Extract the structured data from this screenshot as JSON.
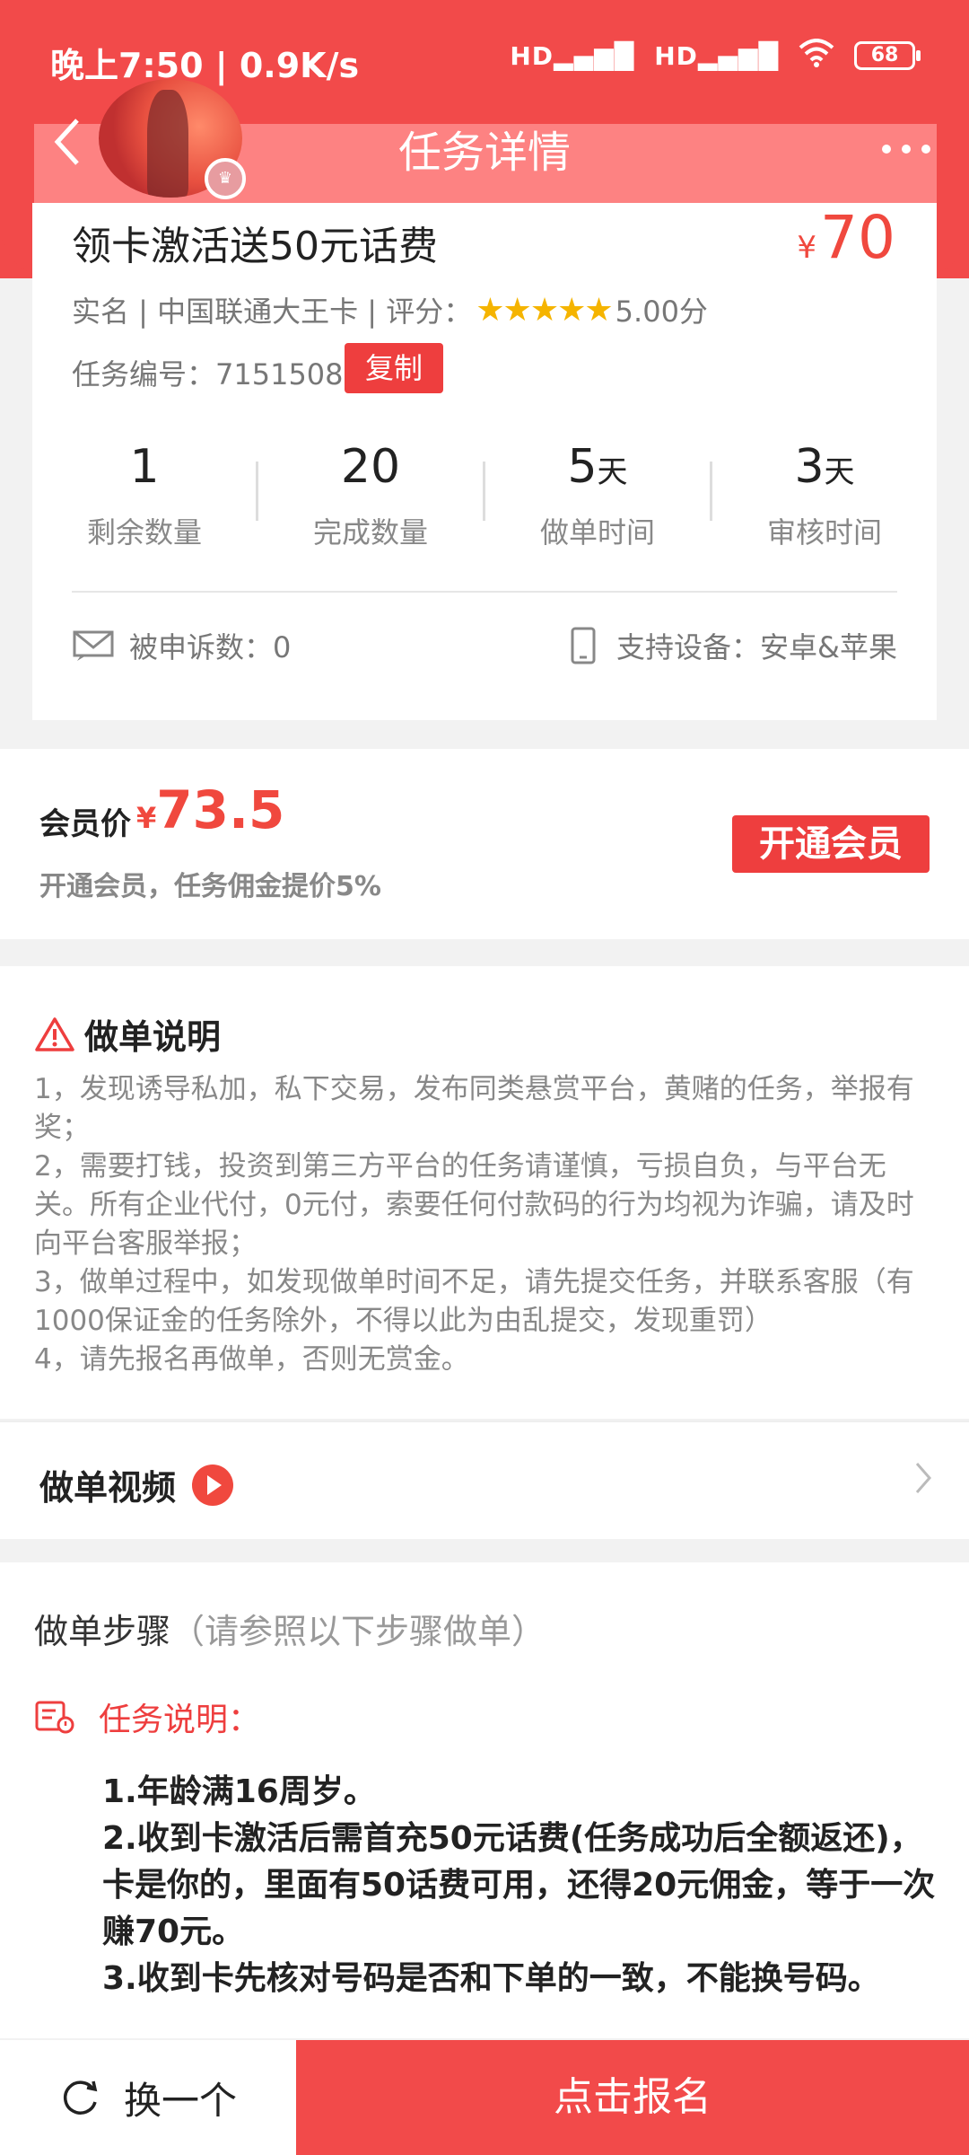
{
  "status_bar": {
    "time": "晚上7:50 | 0.9K/s",
    "signal_1": "HD▂▄▆█",
    "signal_2": "HD▂▄▆█",
    "battery": "68"
  },
  "nav": {
    "title": "任务详情",
    "back_icon": "chevron-left-icon",
    "more_icon": "more-dots-icon"
  },
  "task": {
    "title": "领卡激活送50元话费",
    "price_symbol": "¥",
    "price": "70",
    "meta_prefix": "实名 | 中国联通大王卡 | 评分：",
    "rating_stars": 5,
    "rating_text": "5.00分",
    "id_label": "任务编号：7151508",
    "copy_label": "复制",
    "stats": [
      {
        "num": "1",
        "unit": "",
        "label": "剩余数量"
      },
      {
        "num": "20",
        "unit": "",
        "label": "完成数量"
      },
      {
        "num": "5",
        "unit": "天",
        "label": "做单时间"
      },
      {
        "num": "3",
        "unit": "天",
        "label": "审核时间"
      }
    ],
    "complaint_text": "被申诉数：0",
    "device_text": "支持设备：安卓&苹果"
  },
  "member": {
    "label": "会员价",
    "price_symbol": "¥",
    "price": "73.5",
    "note": "开通会员，任务佣金提价5%",
    "button": "开通会员"
  },
  "instructions": {
    "title": "做单说明",
    "lines": [
      "1，发现诱导私加，私下交易，发布同类悬赏平台，黄赌的任务，举报有奖；",
      "2，需要打钱，投资到第三方平台的任务请谨慎，亏损自负，与平台无关。所有企业代付，0元付，索要任何付款码的行为均视为诈骗，请及时向平台客服举报；",
      "3，做单过程中，如发现做单时间不足，请先提交任务，并联系客服（有1000保证金的任务除外，不得以此为由乱提交，发现重罚）",
      "4，请先报名再做单，否则无赏金。"
    ]
  },
  "video": {
    "label": "做单视频"
  },
  "steps": {
    "title": "做单步骤",
    "subtitle": "（请参照以下步骤做单）",
    "desc_label": "任务说明：",
    "desc_lines": [
      "1.年龄满16周岁。",
      "2.收到卡激活后需首充50元话费(任务成功后全额返还)，卡是你的，里面有50话费可用，还得20元佣金，等于一次赚70元。",
      "3.收到卡先核对号码是否和下单的一致，不能换号码。"
    ]
  },
  "bottom": {
    "refresh_label": "换一个",
    "signup_label": "点击报名"
  },
  "colors": {
    "brand_red": "#f24a4a",
    "price_red": "#f0483e",
    "star": "#f5b400"
  }
}
